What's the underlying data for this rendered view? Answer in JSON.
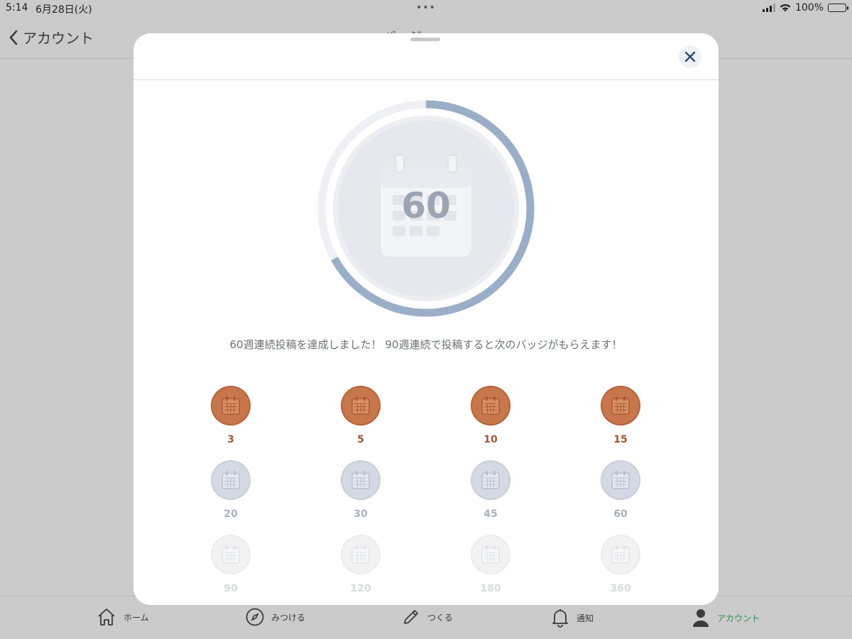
{
  "status_bar": {
    "time": "5:14",
    "date": "6月28日(火)",
    "battery": "100%"
  },
  "nav": {
    "back_label": "アカウント",
    "title": "バッジ"
  },
  "tabbar": {
    "items": [
      {
        "label": "ホーム",
        "icon": "home-icon"
      },
      {
        "label": "みつける",
        "icon": "compass-icon"
      },
      {
        "label": "つくる",
        "icon": "pencil-icon"
      },
      {
        "label": "通知",
        "icon": "bell-icon"
      },
      {
        "label": "アカウント",
        "icon": "person-icon",
        "active": true
      }
    ]
  },
  "modal": {
    "featured_badge": {
      "number": "60",
      "progress": 0.67,
      "icon": "calendar-icon",
      "ring_color": "#9aaec8",
      "track_color": "#eef0f3"
    },
    "message": "60週連続投稿を達成しました！ 90週連続で投稿すると次のバッジがもらえます！",
    "badges": [
      {
        "label": "3",
        "state": "earned"
      },
      {
        "label": "5",
        "state": "earned"
      },
      {
        "label": "10",
        "state": "earned"
      },
      {
        "label": "15",
        "state": "earned"
      },
      {
        "label": "20",
        "state": "current"
      },
      {
        "label": "30",
        "state": "current"
      },
      {
        "label": "45",
        "state": "current"
      },
      {
        "label": "60",
        "state": "current"
      },
      {
        "label": "90",
        "state": "locked"
      },
      {
        "label": "120",
        "state": "locked"
      },
      {
        "label": "180",
        "state": "locked"
      },
      {
        "label": "360",
        "state": "locked"
      }
    ],
    "colors": {
      "earned": "#c8764b",
      "current": "#d5d9e3",
      "locked": "#f2f2f3",
      "active_tab": "#2e8b57"
    }
  }
}
